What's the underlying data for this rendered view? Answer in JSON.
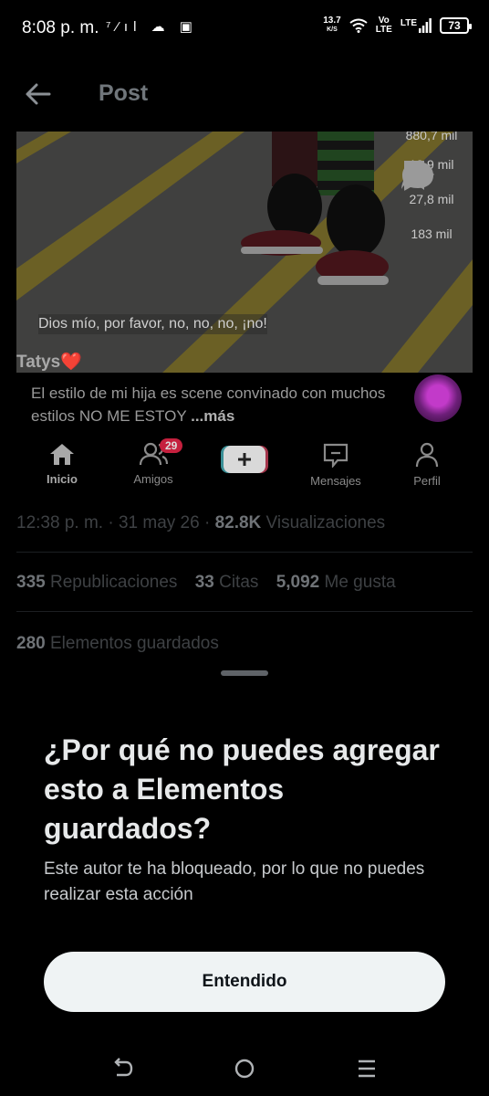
{
  "status_bar": {
    "time": "8:08 p. m.",
    "left_icons": "⁷⁄ıl ☁ ▣",
    "net_speed_value": "13.7",
    "net_speed_unit": "K/S",
    "volte_top": "Vo",
    "volte_bottom": "LTE",
    "lte": "LTE",
    "battery": "73"
  },
  "header": {
    "title": "Post"
  },
  "media": {
    "caption": "Dios mío, por favor, no, no, no, ¡no!",
    "top_partial_count": "880,7 mil",
    "comments_count": "13,9 mil",
    "saves_count": "27,8 mil",
    "shares_count": "183 mil",
    "author": "Tatys❤️",
    "description": "El estilo  de mi hija es scene convinado con  muchos estilos   NO ME ESTOY ",
    "more": "...más",
    "nav": {
      "home": "Inicio",
      "friends": "Amigos",
      "friends_badge": "29",
      "messages": "Mensajes",
      "profile": "Perfil"
    }
  },
  "stats": {
    "time": "12:38 p. m.",
    "sep1": " · ",
    "date": "31 may 26",
    "sep2": " · ",
    "views_value": "82.8K",
    "views_label": " Visualizaciones",
    "reposts_value": "335",
    "reposts_label": " Republicaciones",
    "quotes_value": "33",
    "quotes_label": " Citas",
    "likes_value": "5,092",
    "likes_label": " Me gusta",
    "bookmarks_value": "280",
    "bookmarks_label": " Elementos guardados"
  },
  "sheet": {
    "title": "¿Por qué no puedes agregar esto a Elementos guardados?",
    "body": "Este autor te ha bloqueado, por lo que no puedes realizar esta acción",
    "button": "Entendido"
  }
}
